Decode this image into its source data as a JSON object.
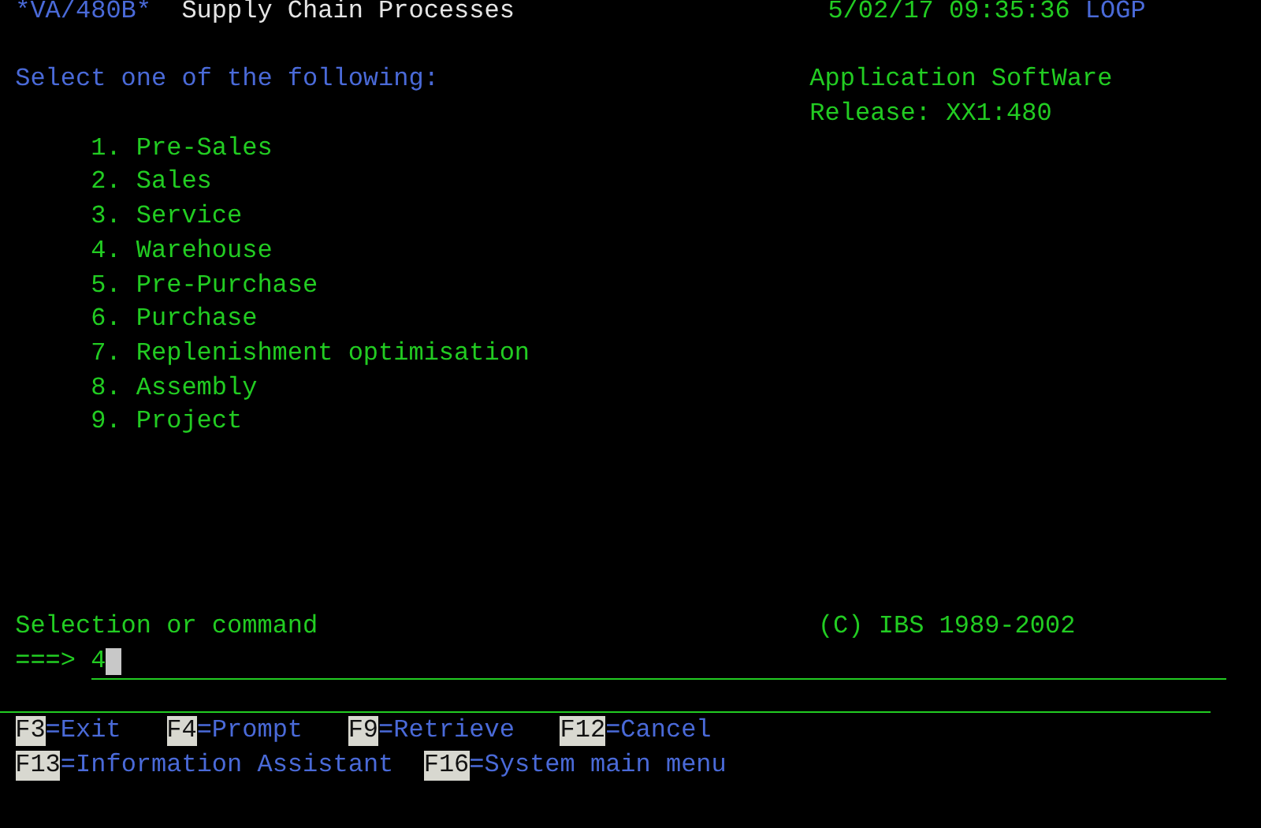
{
  "header": {
    "screen_id": "*VA/480B*",
    "title": "Supply Chain Processes",
    "datetime": "5/02/17 09:35:36",
    "user": "LOGP"
  },
  "prompt": "Select one of the following:",
  "product": {
    "name": "Application SoftWare",
    "release": "Release: XX1:480"
  },
  "menu": [
    {
      "number": "1.",
      "label": "Pre-Sales"
    },
    {
      "number": "2.",
      "label": "Sales"
    },
    {
      "number": "3.",
      "label": "Service"
    },
    {
      "number": "4.",
      "label": "Warehouse"
    },
    {
      "number": "5.",
      "label": "Pre-Purchase"
    },
    {
      "number": "6.",
      "label": "Purchase"
    },
    {
      "number": "7.",
      "label": "Replenishment optimisation"
    },
    {
      "number": "8.",
      "label": "Assembly"
    },
    {
      "number": "9.",
      "label": "Project"
    }
  ],
  "command": {
    "label": "Selection or command",
    "arrow": "===>",
    "value": "4"
  },
  "copyright": "(C) IBS 1989-2002",
  "function_key_rows": [
    [
      {
        "key": "F3",
        "action": "=Exit"
      },
      {
        "key": "F4",
        "action": "=Prompt"
      },
      {
        "key": "F9",
        "action": "=Retrieve"
      },
      {
        "key": "F12",
        "action": "=Cancel"
      }
    ],
    [
      {
        "key": "F13",
        "action": "=Information Assistant"
      },
      {
        "key": "F16",
        "action": "=System main menu"
      }
    ]
  ]
}
